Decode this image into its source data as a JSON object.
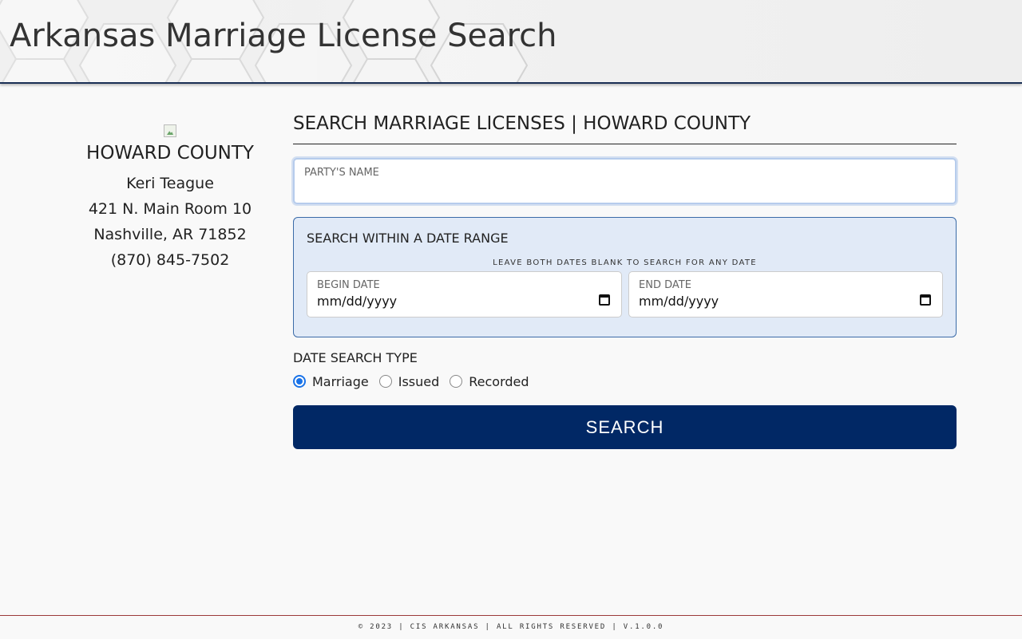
{
  "header": {
    "title": "Arkansas Marriage License Search"
  },
  "sidebar": {
    "county_name": "HOWARD COUNTY",
    "clerk_name": "Keri Teague",
    "address_line1": "421 N. Main Room 10",
    "address_line2": "Nashville, AR 71852",
    "phone": "(870) 845-7502"
  },
  "main": {
    "heading": "SEARCH MARRIAGE LICENSES | HOWARD COUNTY",
    "party_name": {
      "label": "PARTY'S NAME",
      "value": "",
      "placeholder": ""
    },
    "date_range": {
      "title": "SEARCH WITHIN A DATE RANGE",
      "hint": "LEAVE BOTH DATES BLANK TO SEARCH FOR ANY DATE",
      "begin_label": "BEGIN DATE",
      "begin_value": "mm/dd/yyyy",
      "end_label": "END DATE",
      "end_value": "mm/dd/yyyy"
    },
    "date_search_type": {
      "label": "DATE SEARCH TYPE",
      "options": [
        {
          "label": "Marriage",
          "checked": true
        },
        {
          "label": "Issued",
          "checked": false
        },
        {
          "label": "Recorded",
          "checked": false
        }
      ]
    },
    "search_button": "SEARCH"
  },
  "footer": {
    "text": "© 2023 | CIS ARKANSAS | ALL RIGHTS RESERVED | V.1.0.0"
  },
  "colors": {
    "primary_navy": "#012865",
    "radio_accent": "#1a73e8",
    "range_box_bg": "#e1eaf7",
    "footer_rule": "#9b3a3a"
  },
  "icons": {
    "calendar": "calendar-icon",
    "county_logo": "broken-image-icon"
  }
}
